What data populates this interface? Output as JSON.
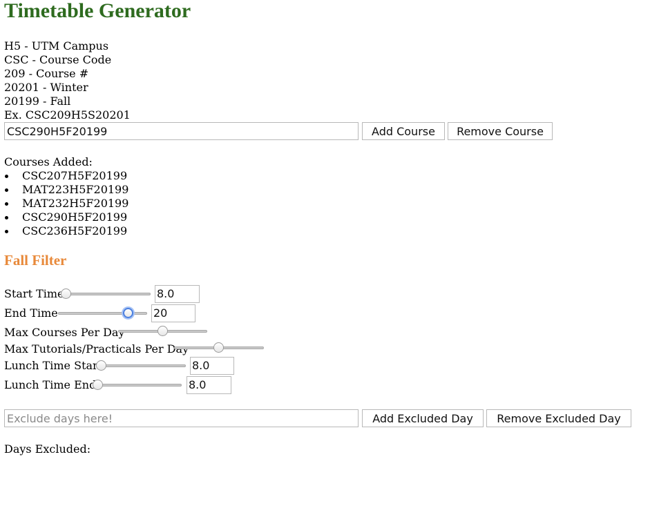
{
  "header": {
    "title": "Timetable Generator"
  },
  "info_lines": [
    "H5 - UTM Campus",
    "CSC - Course Code",
    "209 - Course #",
    "20201 - Winter",
    "20199 - Fall",
    "Ex. CSC209H5S20201"
  ],
  "course_form": {
    "input_value": "CSC290H5F20199",
    "add_label": "Add Course",
    "remove_label": "Remove Course"
  },
  "courses": {
    "heading": "Courses Added:",
    "items": [
      "CSC207H5F20199",
      "MAT223H5F20199",
      "MAT232H5F20199",
      "CSC290H5F20199",
      "CSC236H5F20199"
    ]
  },
  "filter": {
    "heading": "Fall Filter",
    "sliders": [
      {
        "label": "Start Time",
        "value_text": "8.0",
        "fraction": 0.0
      },
      {
        "label": "End Time",
        "value_text": "20",
        "fraction": 0.83
      },
      {
        "label": "Max Courses Per Day",
        "value_text": "",
        "fraction": 0.5
      },
      {
        "label": "Max Tutorials/Practicals Per Day",
        "value_text": "",
        "fraction": 0.5
      },
      {
        "label": "Lunch Time Start",
        "value_text": "8.0",
        "fraction": 0.0
      },
      {
        "label": "Lunch Time End",
        "value_text": "8.0",
        "fraction": 0.0
      }
    ]
  },
  "exclude_form": {
    "placeholder": "Exclude days here!",
    "add_label": "Add Excluded Day",
    "remove_label": "Remove Excluded Day"
  },
  "days_excluded": {
    "heading": "Days Excluded:"
  }
}
